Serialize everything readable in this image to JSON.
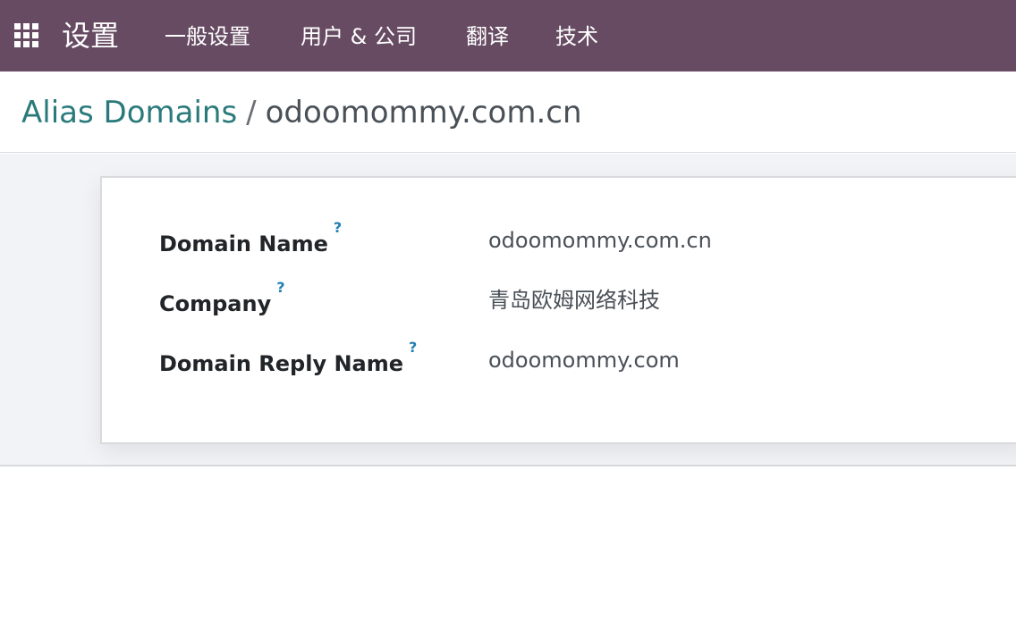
{
  "navbar": {
    "app_name": "设置",
    "apps_icon": "grid-icon",
    "menu": [
      "一般设置",
      "用户 & 公司",
      "翻译",
      "技术"
    ],
    "bg_color": "#664b62"
  },
  "breadcrumb": {
    "parent": "Alias Domains",
    "separator": "/",
    "current": "odoomommy.com.cn"
  },
  "form": {
    "help_mark": "?",
    "fields": [
      {
        "label": "Domain Name",
        "value": "odoomommy.com.cn"
      },
      {
        "label": "Company",
        "value": "青岛欧姆网络科技"
      },
      {
        "label": "Domain Reply Name",
        "value": "odoomommy.com"
      }
    ]
  },
  "colors": {
    "link": "#2a7a7b",
    "help": "#1f7fb3"
  }
}
